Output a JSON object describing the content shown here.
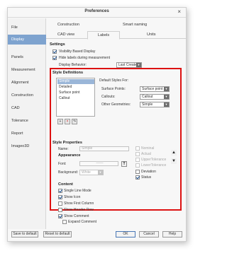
{
  "window": {
    "title": "Preferences",
    "close_glyph": "×"
  },
  "sidebar": {
    "items": [
      {
        "label": "File",
        "active": false
      },
      {
        "label": "Display",
        "active": true
      },
      {
        "label": "Panels",
        "active": false
      },
      {
        "label": "Measurement",
        "active": false
      },
      {
        "label": "Alignment",
        "active": false
      },
      {
        "label": "Construction",
        "active": false
      },
      {
        "label": "CAD",
        "active": false
      },
      {
        "label": "Tolerance",
        "active": false
      },
      {
        "label": "Report",
        "active": false
      },
      {
        "label": "Imageo3D",
        "active": false
      }
    ]
  },
  "tabs": {
    "row1": [
      "Construction",
      "Smart naming"
    ],
    "row2": [
      "CAD view",
      "Labels",
      "Units"
    ],
    "selected": "Labels"
  },
  "settings": {
    "title": "Settings",
    "visibility_label": "Visibility Based Display",
    "visibility_checked": true,
    "hide_label": "Hide labels during measurement",
    "hide_checked": true,
    "display_behavior_label": "Display Behavior:",
    "display_behavior_value": "Last Created"
  },
  "style_definitions": {
    "title": "Style Definitions",
    "items": [
      "Simple",
      "Detailed",
      "Surface point",
      "Callout"
    ],
    "selected": "Simple",
    "default_styles_label": "Default Styles For:",
    "rows": [
      {
        "label": "Surface Points:",
        "value": "Surface point"
      },
      {
        "label": "Callouts:",
        "value": "Callout"
      },
      {
        "label": "Other Geometries:",
        "value": "Simple"
      }
    ],
    "buttons": [
      "+",
      "×",
      "↷"
    ]
  },
  "style_properties": {
    "title": "Style Properties",
    "name_label": "Name:",
    "name_value": "Simple",
    "appearance_title": "Appearance",
    "font_label": "Font:",
    "font_value": "——",
    "font_button": "T",
    "background_label": "Background:",
    "background_value": "White",
    "right_checks": [
      {
        "label": "Nominal",
        "checked": false,
        "enabled": false
      },
      {
        "label": "Actual",
        "checked": false,
        "enabled": false
      },
      {
        "label": "UpperTolerance",
        "checked": false,
        "enabled": false
      },
      {
        "label": "LowerTolerance",
        "checked": false,
        "enabled": false
      },
      {
        "label": "Deviation",
        "checked": false,
        "enabled": true
      },
      {
        "label": "Status",
        "checked": true,
        "enabled": true
      }
    ],
    "up_arrow": "▲",
    "down_arrow": "▼"
  },
  "content": {
    "title": "Content",
    "items": [
      {
        "label": "Single Line Mode",
        "checked": true
      },
      {
        "label": "Show Icon",
        "checked": true
      },
      {
        "label": "Show First Column",
        "checked": false
      },
      {
        "label": "Show Header Row",
        "checked": false
      },
      {
        "label": "Show Comment",
        "checked": true
      },
      {
        "label": "Expand Comment",
        "checked": false
      }
    ]
  },
  "footer": {
    "save_default": "Save to default",
    "reset_default": "Reset to default",
    "ok": "OK",
    "cancel": "Cancel",
    "help": "Help"
  },
  "colors": {
    "accent": "#7ea3cf",
    "highlight_box": "#dd1111"
  }
}
